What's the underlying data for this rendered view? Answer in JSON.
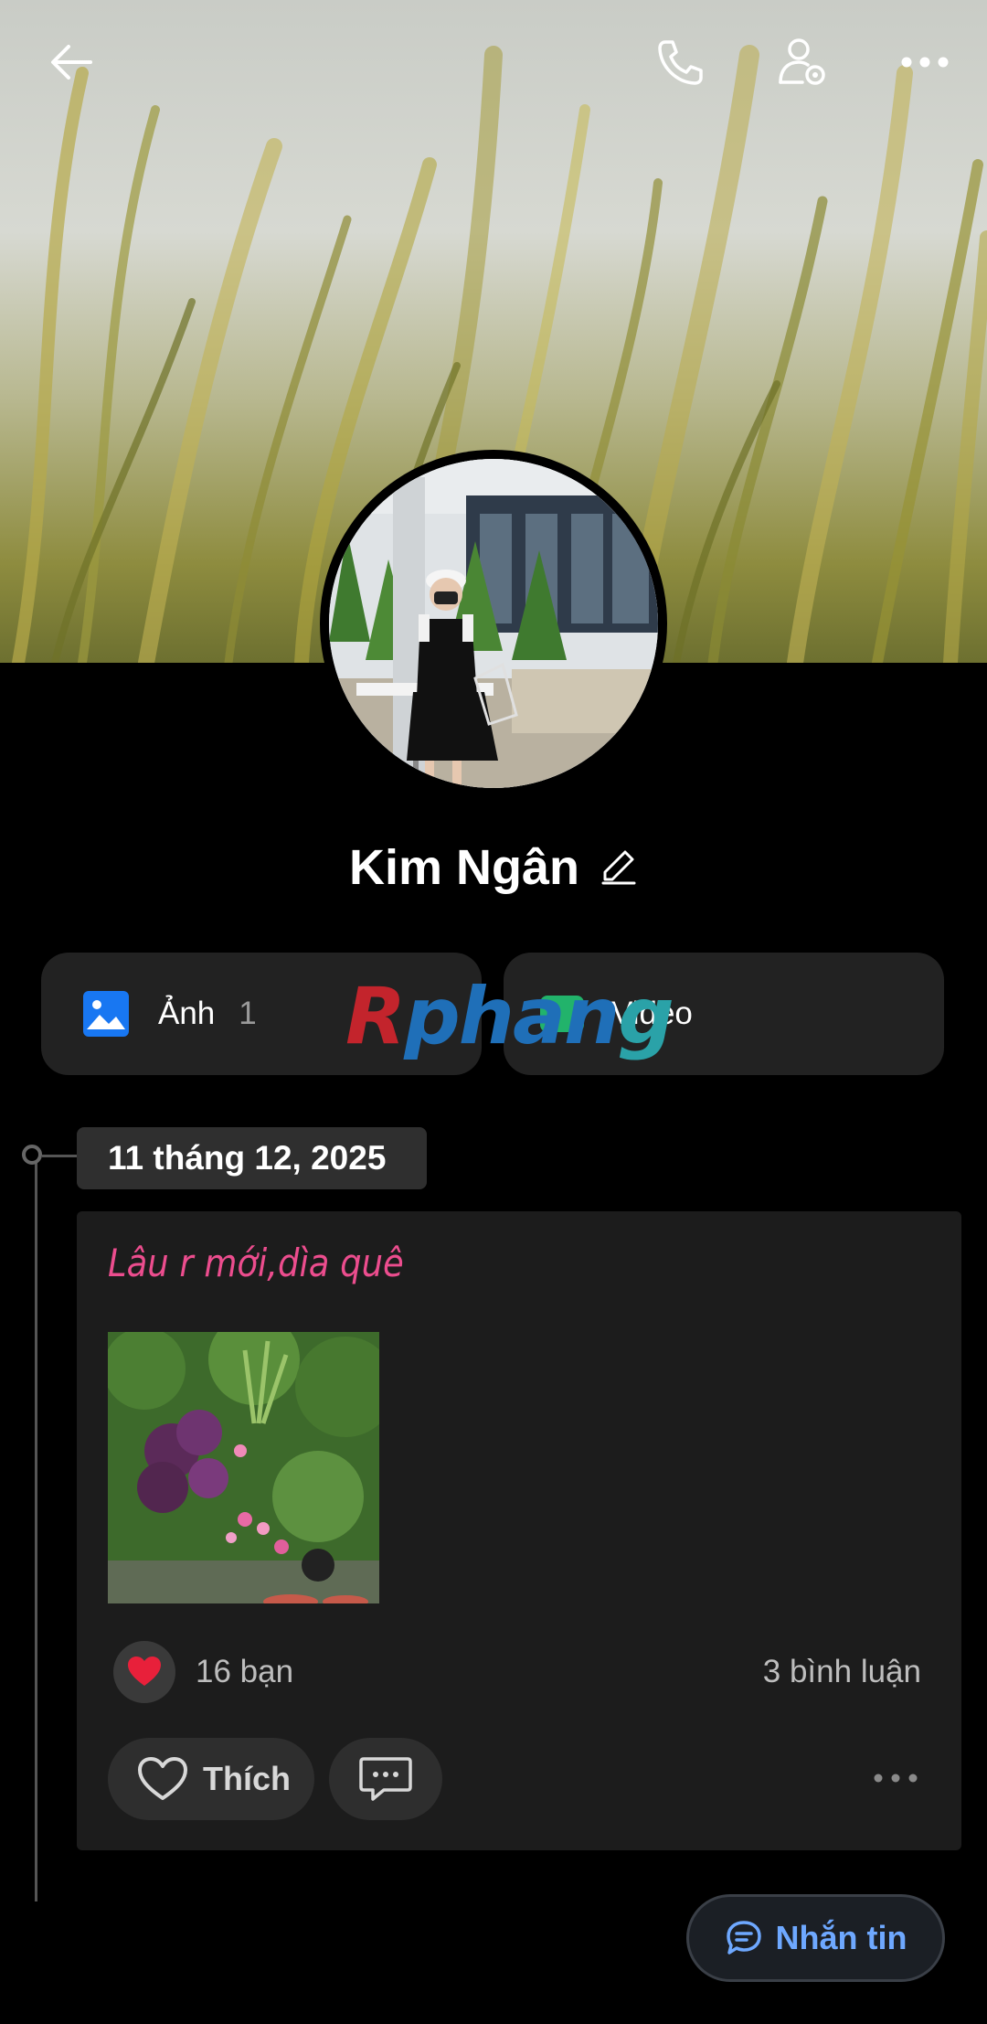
{
  "header": {
    "back_icon": "arrow-left-icon",
    "call_icon": "phone-icon",
    "profile_settings_icon": "user-gear-icon",
    "more_icon": "more-horizontal-icon"
  },
  "profile": {
    "name": "Kim Ngân",
    "edit_icon": "pencil-icon"
  },
  "media": {
    "photos_label": "Ảnh",
    "photos_count": "1",
    "videos_label": "Video"
  },
  "watermark": {
    "part1": "R",
    "part2": "phan",
    "part3": "g"
  },
  "timeline": {
    "date": "11 tháng 12, 2025",
    "post": {
      "text": "Lâu r mới,dìa quê",
      "reaction_icon": "heart",
      "friends_label": "16 bạn",
      "comments_label": "3 bình luận",
      "like_label": "Thích"
    }
  },
  "message_button": {
    "label": "Nhắn tin"
  },
  "colors": {
    "accent": "#6ea8ff",
    "post_text": "#ec4d8e",
    "photo_icon": "#1877f2"
  }
}
